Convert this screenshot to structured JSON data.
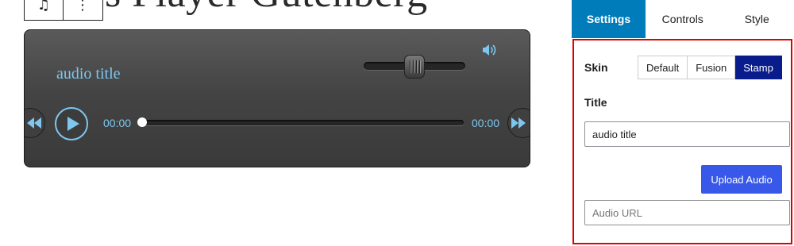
{
  "toolbar": {
    "block_icon": "music-note-icon",
    "more_icon": "vertical-ellipsis-icon",
    "block_glyph": "♫",
    "more_glyph": "⋮"
  },
  "heading": {
    "text": "s Player Gutenberg"
  },
  "player": {
    "title": "audio title",
    "current_time": "00:00",
    "total_time": "00:00",
    "progress": 0,
    "volume_level": 0.5,
    "accent_color": "#7ec7f0",
    "icons": {
      "volume": "speaker-volume-icon",
      "rewind": "rewind-icon",
      "play": "play-icon",
      "forward": "fast-forward-icon"
    }
  },
  "settings": {
    "tabs": [
      {
        "label": "Settings",
        "active": true
      },
      {
        "label": "Controls",
        "active": false
      },
      {
        "label": "Style",
        "active": false
      }
    ],
    "skin_label": "Skin",
    "skins": [
      {
        "label": "Default",
        "active": false
      },
      {
        "label": "Fusion",
        "active": false
      },
      {
        "label": "Stamp",
        "active": true
      }
    ],
    "title_label": "Title",
    "title_value": "audio title",
    "upload_label": "Upload Audio",
    "url_placeholder": "Audio URL",
    "url_value": "",
    "colors": {
      "active_tab": "#007cba",
      "active_skin": "#081c8c",
      "upload_button": "#3858e9",
      "highlight_border": "#e00000"
    }
  }
}
